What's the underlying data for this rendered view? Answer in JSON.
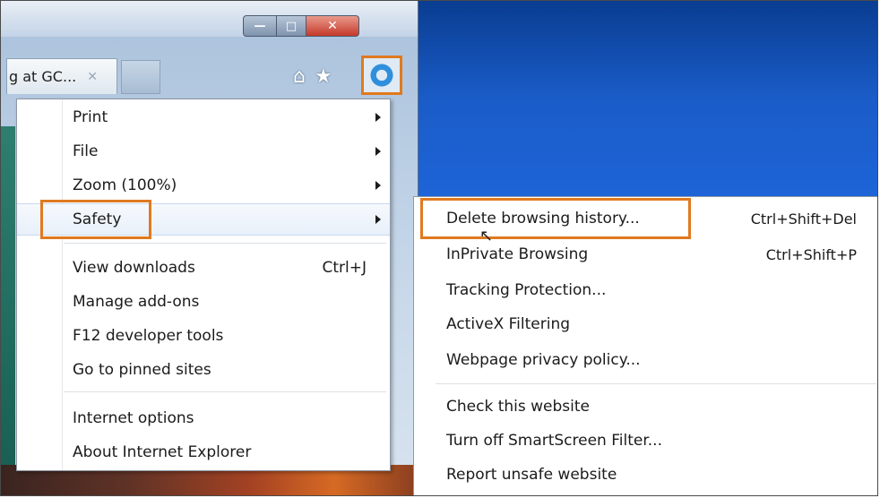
{
  "window": {
    "controls": {
      "minimize": "—",
      "maximize": "□",
      "close": "✕"
    },
    "tab": {
      "title": "g at GC...",
      "close": "✕"
    }
  },
  "toolbar": {
    "home_icon": "⌂",
    "favorites_icon": "★"
  },
  "menu": {
    "items": [
      {
        "label": "Print",
        "submenu": true
      },
      {
        "label": "File",
        "submenu": true
      },
      {
        "label": "Zoom (100%)",
        "submenu": true
      },
      {
        "label": "Safety",
        "submenu": true,
        "highlighted": true
      },
      {
        "label": "View downloads",
        "shortcut": "Ctrl+J"
      },
      {
        "label": "Manage add-ons"
      },
      {
        "label": "F12 developer tools"
      },
      {
        "label": "Go to pinned sites"
      },
      {
        "label": "Internet options"
      },
      {
        "label": "About Internet Explorer"
      }
    ]
  },
  "submenu": {
    "items": [
      {
        "label": "Delete browsing history...",
        "shortcut": "Ctrl+Shift+Del"
      },
      {
        "label": "InPrivate Browsing",
        "shortcut": "Ctrl+Shift+P"
      },
      {
        "label": "Tracking Protection..."
      },
      {
        "label": "ActiveX Filtering"
      },
      {
        "label": "Webpage privacy policy..."
      },
      {
        "label": "Check this website"
      },
      {
        "label": "Turn off SmartScreen Filter..."
      },
      {
        "label": "Report unsafe website"
      }
    ]
  },
  "colors": {
    "highlight": "#e07a1f",
    "desktop": "#1a5cc8"
  }
}
